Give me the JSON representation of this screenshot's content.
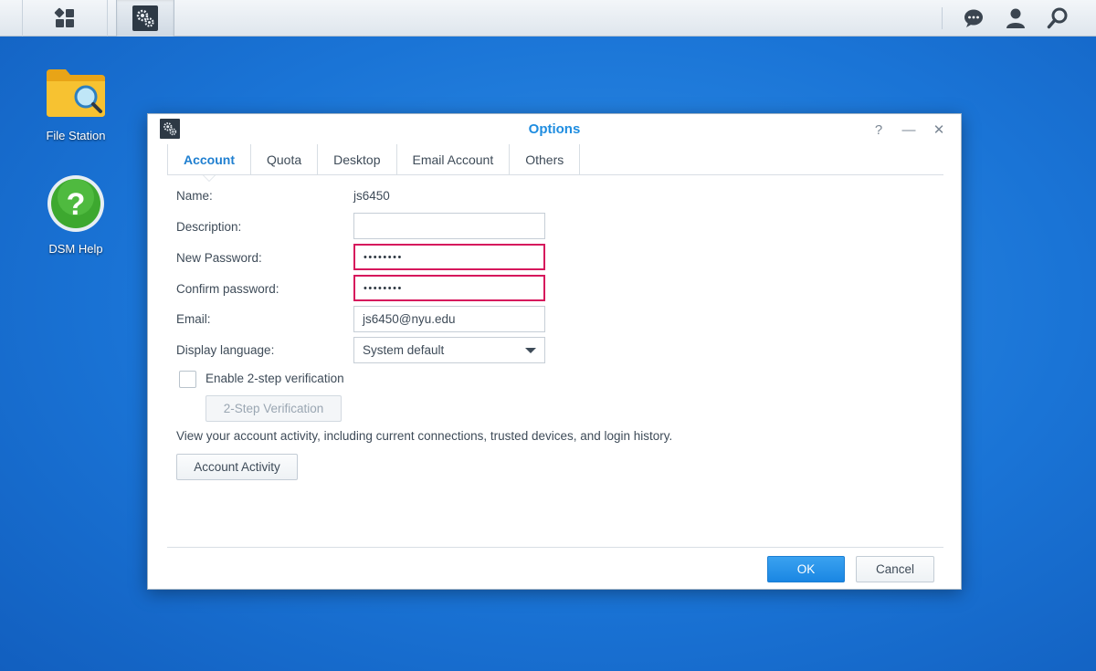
{
  "taskbar": {
    "main_menu_icon": "main-menu-icon",
    "app_icon": "control-panel-gear-icon",
    "right_icons": [
      "chat-icon",
      "user-icon",
      "search-icon"
    ]
  },
  "desktop": {
    "icons": [
      {
        "label": "File Station",
        "icon": "folder-search-icon"
      },
      {
        "label": "DSM Help",
        "icon": "help-icon"
      }
    ]
  },
  "window": {
    "title": "Options",
    "controls": {
      "help": "?",
      "minimize": "—",
      "close": "✕"
    },
    "tabs": [
      "Account",
      "Quota",
      "Desktop",
      "Email Account",
      "Others"
    ],
    "active_tab": "Account",
    "form": {
      "name_label": "Name:",
      "name_value": "js6450",
      "description_label": "Description:",
      "description_value": "",
      "new_password_label": "New Password:",
      "new_password_value": "••••••••",
      "confirm_password_label": "Confirm password:",
      "confirm_password_value": "••••••••",
      "email_label": "Email:",
      "email_value": "js6450@nyu.edu",
      "language_label": "Display language:",
      "language_value": "System default",
      "two_step_checkbox_label": "Enable 2-step verification",
      "two_step_checked": false,
      "two_step_button": "2-Step Verification",
      "activity_text": "View your account activity, including current connections, trusted devices, and login history.",
      "activity_button": "Account Activity"
    },
    "footer": {
      "ok": "OK",
      "cancel": "Cancel"
    }
  },
  "colors": {
    "accent": "#1f8de0",
    "highlight_border": "#d6175c",
    "desktop_bg": "#1a74d6"
  }
}
